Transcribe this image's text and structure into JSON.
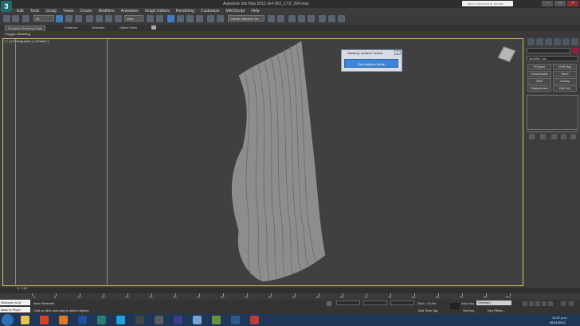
{
  "window": {
    "title": "Autodesk 3ds Max 2012 x64       ISO_CYZ_004.max",
    "search_placeholder": "Type a keyword or phrase",
    "logo_text": "3"
  },
  "menu": [
    "Edit",
    "Tools",
    "Group",
    "Views",
    "Create",
    "Modifiers",
    "Animation",
    "Graph Editors",
    "Rendering",
    "Customize",
    "MAXScript",
    "Help"
  ],
  "toolbar": {
    "filter_value": "All",
    "view_value": "View",
    "selection_set": "Create Selection Se"
  },
  "ribbon": {
    "tabs": [
      "Graphite Modeling Tools",
      "Freeform",
      "Selection",
      "Object Paint"
    ],
    "subpanel": "Polygon Modeling"
  },
  "viewport": {
    "label": "[ + ] [ Orthographic ] [ Shaded ]"
  },
  "dialog": {
    "title": "Warning: Isolated Selecti...",
    "close": "x",
    "button": "Exit Isolation Mode"
  },
  "command_panel": {
    "modifier_list": "Modifier List",
    "buttons": [
      "FFD(box)",
      "UVW Map",
      "TurboSmooth",
      "Bevel",
      "Shell",
      "Unwrap",
      "Displacement",
      "Edit Poly"
    ]
  },
  "timeline": {
    "slider_label": "0 / 100",
    "ticks": [
      "0",
      "5",
      "10",
      "15",
      "20",
      "25",
      "30",
      "35",
      "40",
      "45",
      "50",
      "55",
      "60",
      "65",
      "70",
      "75",
      "80",
      "85",
      "90",
      "95",
      "100"
    ]
  },
  "status": {
    "maxscript": "Welcome to M",
    "back_to": "Back to Phyto",
    "line1": "None Selected",
    "line2": "Click or click-and-drag to select objects",
    "grid": "Grid = 10,0m",
    "add_time_tag": "Add Time Tag",
    "auto_key": "Auto Key",
    "selected": "Selected",
    "set_key": "Set Key",
    "key_filters": "Key Filters..."
  },
  "taskbar": {
    "time": "12:47 p.m.",
    "date": "06/11/2012"
  }
}
